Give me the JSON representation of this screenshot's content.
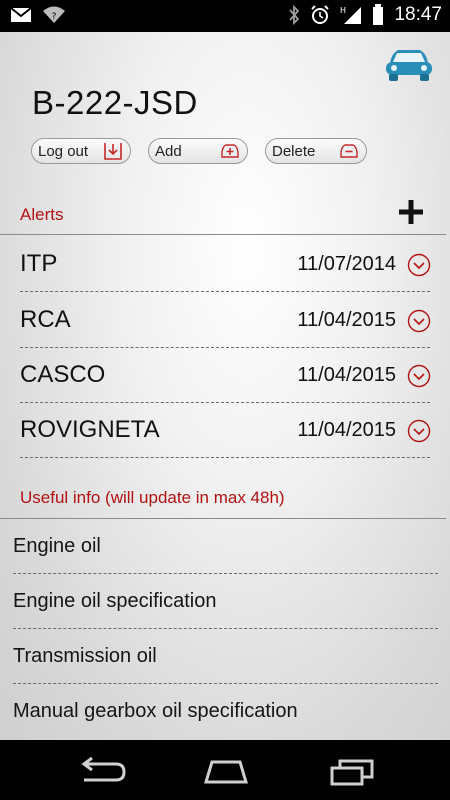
{
  "status_bar": {
    "time": "18:47"
  },
  "header": {
    "plate": "B-222-JSD"
  },
  "buttons": {
    "logout_label": "Log out",
    "add_label": "Add",
    "delete_label": "Delete"
  },
  "alerts": {
    "title": "Alerts",
    "items": [
      {
        "name": "ITP",
        "date": "11/07/2014"
      },
      {
        "name": "RCA",
        "date": "11/04/2015"
      },
      {
        "name": "CASCO",
        "date": "11/04/2015"
      },
      {
        "name": "ROVIGNETA",
        "date": "11/04/2015"
      }
    ]
  },
  "useful_info": {
    "title": "Useful info (will update in max 48h)",
    "items": [
      {
        "label": "Engine oil"
      },
      {
        "label": "Engine oil specification"
      },
      {
        "label": "Transmission oil"
      },
      {
        "label": "Manual gearbox oil specification"
      }
    ]
  },
  "colors": {
    "accent_red": "#b31212",
    "car_blue": "#2a8fb8"
  }
}
